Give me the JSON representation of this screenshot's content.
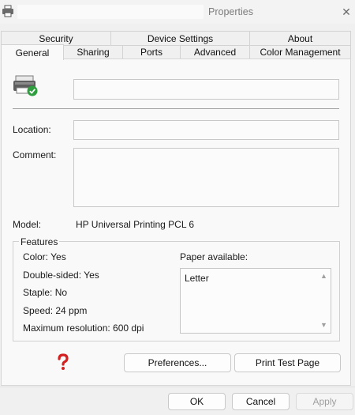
{
  "window": {
    "title": "Properties",
    "icon": "printer-icon",
    "close_symbol": "✕"
  },
  "tabs_row1": [
    {
      "label": "Security"
    },
    {
      "label": "Device Settings"
    },
    {
      "label": "About"
    }
  ],
  "tabs_row2": [
    {
      "label": "General",
      "active": true
    },
    {
      "label": "Sharing"
    },
    {
      "label": "Ports"
    },
    {
      "label": "Advanced"
    },
    {
      "label": "Color Management"
    }
  ],
  "general": {
    "printer_name_value": "",
    "location_label": "Location:",
    "location_value": "",
    "comment_label": "Comment:",
    "comment_value": "",
    "model_label": "Model:",
    "model_value": "HP Universal Printing PCL 6"
  },
  "features": {
    "legend": "Features",
    "color": "Color: Yes",
    "double_sided": "Double-sided: Yes",
    "staple": "Staple: No",
    "speed": "Speed: 24 ppm",
    "max_resolution": "Maximum resolution: 600 dpi",
    "paper_label": "Paper available:",
    "paper_items": [
      "Letter"
    ],
    "scroll_up": "▲",
    "scroll_down": "▼"
  },
  "actions": {
    "help_symbol": "❓",
    "preferences": "Preferences...",
    "print_test_page": "Print Test Page"
  },
  "footer": {
    "ok": "OK",
    "cancel": "Cancel",
    "apply": "Apply"
  },
  "colors": {
    "accent_check": "#2e9e3f",
    "help_red": "#d42020"
  }
}
